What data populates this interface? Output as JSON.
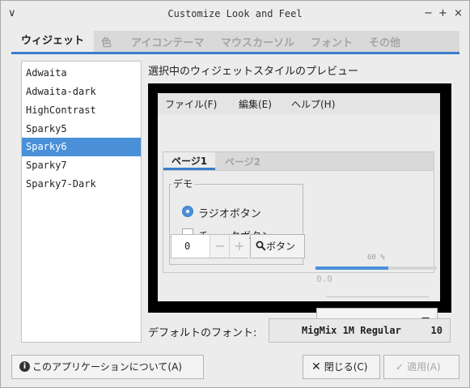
{
  "window": {
    "title": "Customize Look and Feel",
    "menu_icon": "∨",
    "minimize_icon": "−",
    "maximize_icon": "+",
    "close_icon": "×"
  },
  "tabs": [
    "ウィジェット",
    "色",
    "アイコンテーマ",
    "マウスカーソル",
    "フォント",
    "その他"
  ],
  "themes": {
    "items": [
      "Adwaita",
      "Adwaita-dark",
      "HighContrast",
      "Sparky5",
      "Sparky6",
      "Sparky7",
      "Sparky7-Dark"
    ],
    "selected": "Sparky6"
  },
  "preview": {
    "label": "選択中のウィジェットスタイルのプレビュー",
    "menu": [
      "ファイル(F)",
      "編集(E)",
      "ヘルプ(H)"
    ],
    "tabs": [
      "ページ1",
      "ページ2"
    ],
    "frame_label": "デモ",
    "radio_label": "ラジオボタン",
    "check_label": "チェックボタン",
    "spin_value": "0",
    "spin_minus": "−",
    "spin_plus": "+",
    "button_label": "ボタン",
    "progress_text": "60 %",
    "progress_value": 0.6,
    "scale_value": "0.0"
  },
  "font": {
    "label": "デフォルトのフォント:",
    "name": "MigMix 1M Regular",
    "size": "10"
  },
  "buttons": {
    "about": "このアプリケーションについて(A)",
    "close": "閉じる(C)",
    "apply": "適用(A)"
  },
  "colors": {
    "accent": "#4a90d9",
    "window_bg": "#ececec",
    "preview_border": "#000000"
  }
}
